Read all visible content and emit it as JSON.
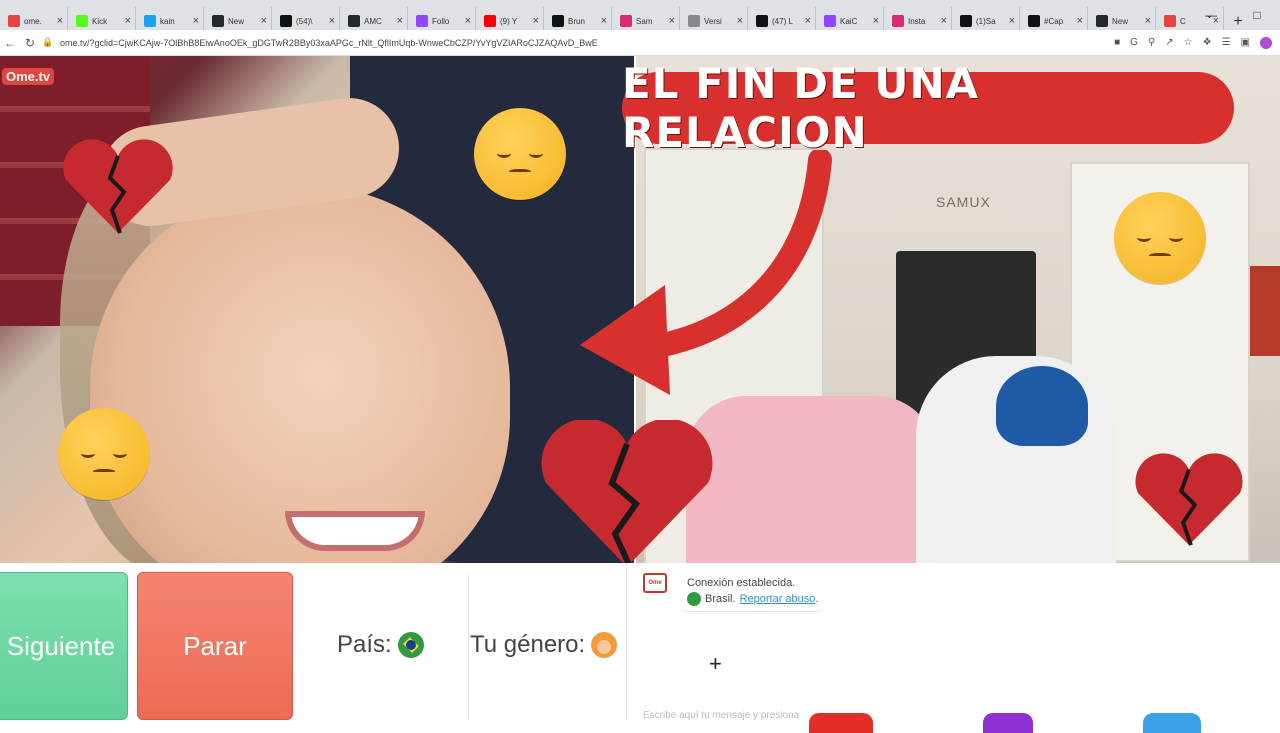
{
  "browser": {
    "tabs": [
      {
        "label": "ome.",
        "icon": "ometv-tab-icon",
        "color": "#e3443e"
      },
      {
        "label": "Kick",
        "icon": "kick-tab-icon",
        "color": "#53fc18"
      },
      {
        "label": "kain",
        "icon": "twitter-tab-icon",
        "color": "#1da1f2"
      },
      {
        "label": "New",
        "icon": "github-tab-icon",
        "color": "#24292e"
      },
      {
        "label": "(54)\\",
        "icon": "tiktok-tab-icon",
        "color": "#111111"
      },
      {
        "label": "AMC",
        "icon": "github-tab-icon",
        "color": "#24292e"
      },
      {
        "label": "Follo",
        "icon": "twitch-tab-icon",
        "color": "#9146ff"
      },
      {
        "label": "(9) Y",
        "icon": "youtube-tab-icon",
        "color": "#ff0000"
      },
      {
        "label": "Brun",
        "icon": "tiktok-tab-icon",
        "color": "#111111"
      },
      {
        "label": "Sam",
        "icon": "instagram-tab-icon",
        "color": "#d62976"
      },
      {
        "label": "Versi",
        "icon": "globe-tab-icon",
        "color": "#888888"
      },
      {
        "label": "(47) L",
        "icon": "tiktok-tab-icon",
        "color": "#111111"
      },
      {
        "label": "KaiC",
        "icon": "twitch-tab-icon",
        "color": "#9146ff"
      },
      {
        "label": "Insta",
        "icon": "instagram-tab-icon",
        "color": "#d62976"
      },
      {
        "label": "(1)Sa",
        "icon": "tiktok-tab-icon",
        "color": "#111111"
      },
      {
        "label": "#Cap",
        "icon": "tiktok-tab-icon",
        "color": "#111111"
      },
      {
        "label": "New",
        "icon": "github-tab-icon",
        "color": "#24292e"
      },
      {
        "label": "C",
        "icon": "ometv-tab-icon",
        "color": "#e3443e"
      }
    ],
    "new_tab_label": "+",
    "url": "ome.tv/?gclid=CjwKCAjw-7OlBhB8EiwAnoOEk_gDGTwR2BBy03xaAPGc_rNlt_QflImUqb-WnweCbCZP/YvYgVZIARoCJZAQAvD_BwE"
  },
  "video": {
    "left_logo": "Ome.tv",
    "right_sign": "SAMUX"
  },
  "overlay": {
    "headline": "EL FIN DE UNA RELACION",
    "headline_color": "#d8302d"
  },
  "controls": {
    "next_label": "Siguiente",
    "stop_label": "Parar",
    "country_label": "País:",
    "gender_label": "Tu género:"
  },
  "chat": {
    "logo_text": "Ome",
    "status": "Conexión establecida.",
    "country": "Brasil.",
    "report_link": "Reportar abuso",
    "report_suffix": ".",
    "add_symbol": "+",
    "input_placeholder": "Escribe aquí tu mensaje y presiona"
  },
  "colors": {
    "next_button": "#6ad6a2",
    "stop_button": "#ef725c",
    "accent_red": "#d8302d"
  }
}
